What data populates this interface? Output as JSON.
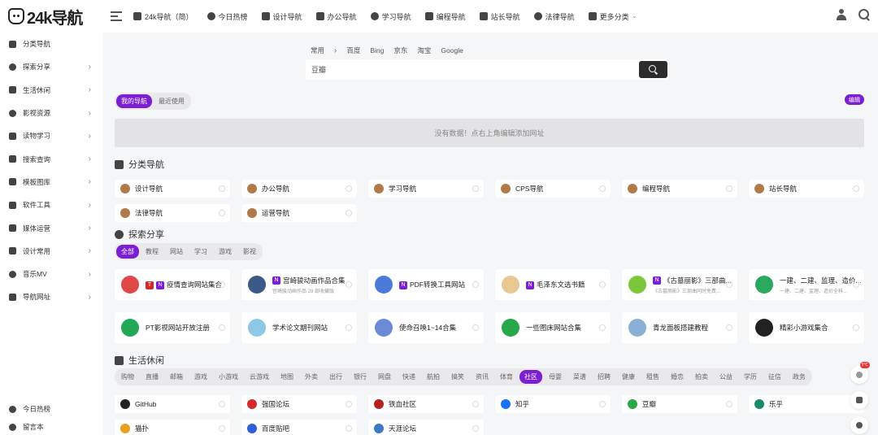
{
  "brand": {
    "name": "24k导航"
  },
  "topnav": [
    {
      "label": "24k导航（简）",
      "icon": "hand-icon"
    },
    {
      "label": "今日热榜",
      "icon": "fire-icon"
    },
    {
      "label": "设计导航",
      "icon": "design-icon"
    },
    {
      "label": "办公导航",
      "icon": "office-icon"
    },
    {
      "label": "学习导航",
      "icon": "study-icon"
    },
    {
      "label": "编程导航",
      "icon": "code-icon"
    },
    {
      "label": "站长导航",
      "icon": "webmaster-icon"
    },
    {
      "label": "法律导航",
      "icon": "law-icon"
    },
    {
      "label": "更多分类",
      "icon": "more-icon"
    }
  ],
  "sidebar": {
    "items": [
      {
        "label": "分类导航",
        "icon": "signpost-icon",
        "chevron": false
      },
      {
        "label": "探索分享",
        "icon": "compass-icon",
        "chevron": true
      },
      {
        "label": "生活休闲",
        "icon": "home-icon",
        "chevron": true
      },
      {
        "label": "影视资源",
        "icon": "film-icon",
        "chevron": true
      },
      {
        "label": "读物学习",
        "icon": "book-icon",
        "chevron": true
      },
      {
        "label": "搜索查询",
        "icon": "search-list-icon",
        "chevron": true
      },
      {
        "label": "模板图库",
        "icon": "image-icon",
        "chevron": true
      },
      {
        "label": "软件工具",
        "icon": "grid-icon",
        "chevron": true
      },
      {
        "label": "媒体运营",
        "icon": "chart-icon",
        "chevron": true
      },
      {
        "label": "设计常用",
        "icon": "brush-icon",
        "chevron": true
      },
      {
        "label": "音乐MV",
        "icon": "music-icon",
        "chevron": true
      },
      {
        "label": "导航网址",
        "icon": "link-icon",
        "chevron": true
      }
    ],
    "bottom": [
      {
        "label": "今日热榜",
        "icon": "fire-icon"
      },
      {
        "label": "留言本",
        "icon": "chat-icon"
      }
    ]
  },
  "search": {
    "tabs": [
      "常用",
      "百度",
      "Bing",
      "京东",
      "淘宝",
      "Google"
    ],
    "separator": "›",
    "query": "豆瓣"
  },
  "mynav": {
    "tabs": [
      "我的导航",
      "最近使用"
    ],
    "active": 0,
    "edit_label": "编辑",
    "empty_text": "没有数据！点右上角编辑添加网址"
  },
  "categories": {
    "title": "分类导航",
    "items": [
      "设计导航",
      "办公导航",
      "学习导航",
      "CPS导航",
      "编程导航",
      "站长导航",
      "法律导航",
      "运营导航"
    ]
  },
  "explore": {
    "title": "探索分享",
    "tabs": [
      "全部",
      "教程",
      "网站",
      "学习",
      "游戏",
      "影视"
    ],
    "active": 0,
    "items": [
      {
        "name": "疫情查询网站集合",
        "badges": [
          "T",
          "N"
        ],
        "desc": "",
        "color": "#e04848"
      },
      {
        "name": "宫崎骏动画作品合集",
        "badges": [
          "N"
        ],
        "desc": "宫崎骏动画作品 28 部收藏版",
        "color": "#3a5a88"
      },
      {
        "name": "PDF转换工具网站",
        "badges": [
          "N"
        ],
        "desc": "",
        "color": "#4a7bd9"
      },
      {
        "name": "毛泽东文选书籍",
        "badges": [
          "N"
        ],
        "desc": "",
        "color": "#e8c890"
      },
      {
        "name": "《古墓丽影》三部曲...",
        "badges": [
          "N"
        ],
        "desc": "《古墓丽影》三部曲同时免费...",
        "color": "#7bc63a"
      },
      {
        "name": "一建、二建、监理、造价...",
        "badges": [],
        "desc": "一建、二建、监理、造价全科...",
        "color": "#2aa860"
      },
      {
        "name": "PT影视网站开放注册",
        "badges": [],
        "desc": "",
        "color": "#1fa855"
      },
      {
        "name": "学术论文期刊网站",
        "badges": [],
        "desc": "",
        "color": "#8ec8e8"
      },
      {
        "name": "使命召唤1~14合集",
        "badges": [],
        "desc": "",
        "color": "#6a8ad8"
      },
      {
        "name": "一些图床网站合集",
        "badges": [],
        "desc": "",
        "color": "#27a84a"
      },
      {
        "name": "青龙面板搭建教程",
        "badges": [],
        "desc": "",
        "color": "#8ab0d8"
      },
      {
        "name": "精彩小游戏集合",
        "badges": [],
        "desc": "",
        "color": "#222222"
      }
    ]
  },
  "life": {
    "title": "生活休闲",
    "tabs": [
      "购物",
      "直播",
      "邮箱",
      "游戏",
      "小游戏",
      "云游戏",
      "地图",
      "外卖",
      "出行",
      "银行",
      "网盘",
      "快递",
      "航拍",
      "搞笑",
      "资讯",
      "体育",
      "社区",
      "母婴",
      "菜谱",
      "招聘",
      "健康",
      "租售",
      "婚恋",
      "拍卖",
      "公益",
      "学历",
      "征信",
      "政务"
    ],
    "active": 16,
    "items": [
      {
        "name": "GitHub",
        "color": "#222222"
      },
      {
        "name": "强国论坛",
        "color": "#d42a2a"
      },
      {
        "name": "铁血社区",
        "color": "#b82020"
      },
      {
        "name": "知乎",
        "color": "#1772f6"
      },
      {
        "name": "豆瓣",
        "color": "#2aa845"
      },
      {
        "name": "乐乎",
        "color": "#1a8a6a"
      },
      {
        "name": "猫扑",
        "color": "#e8a020"
      },
      {
        "name": "百度贴吧",
        "color": "#3060d8"
      },
      {
        "name": "天涯论坛",
        "color": "#3a78c8"
      }
    ]
  },
  "float": {
    "weather_badge": "9℃"
  },
  "colors": {
    "accent": "#7c1fd2",
    "dark": "#2c2c2c",
    "background": "#f5f6f8"
  }
}
